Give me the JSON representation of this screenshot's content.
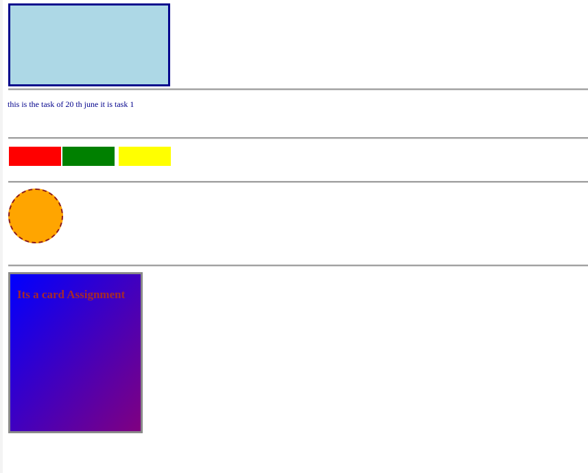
{
  "task": {
    "text": "this is the task of 20 th june it is task 1"
  },
  "color_boxes": [
    {
      "name": "red",
      "color": "#ff0000"
    },
    {
      "name": "green",
      "color": "#008000"
    },
    {
      "name": "yellow",
      "color": "#ffff00"
    }
  ],
  "circle": {
    "fill": "#ffa500",
    "border_color": "#8b1a1a"
  },
  "card": {
    "title": "Its a card Assignment",
    "title_color": "#a52a2a",
    "gradient_start": "#0000ff",
    "gradient_end": "#800080"
  },
  "colors": {
    "box_fill": "#add8e6",
    "box_border": "#00008b",
    "text": "#00008b"
  }
}
